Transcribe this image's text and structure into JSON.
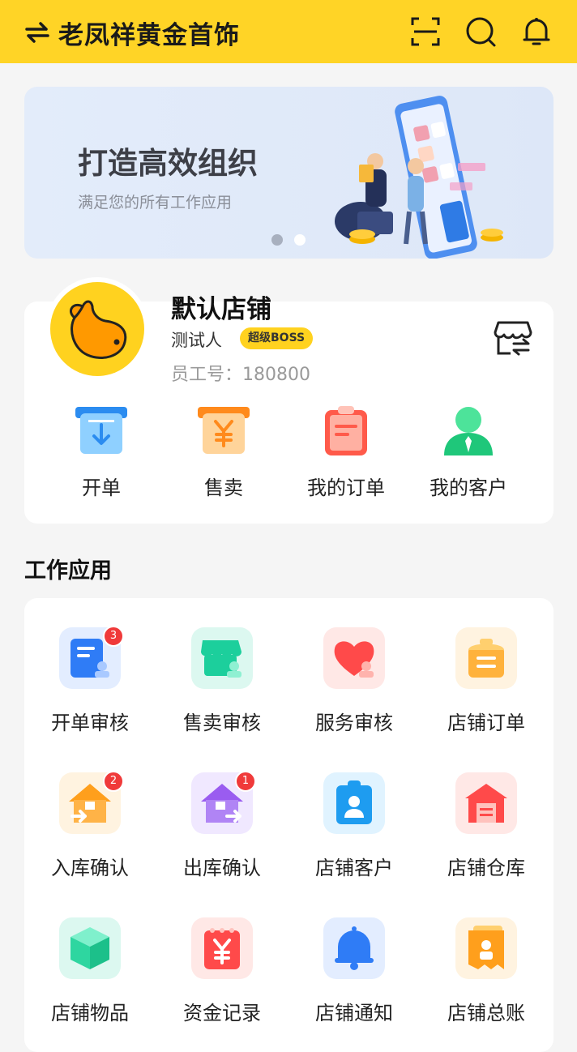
{
  "header": {
    "title": "老凤祥黄金首饰",
    "swap_icon": "swap-arrows-icon",
    "scan_icon": "scan-icon",
    "search_icon": "search-icon",
    "bell_icon": "bell-icon",
    "bg_color": "#ffd426"
  },
  "banner": {
    "title": "打造高效组织",
    "subtitle": "满足您的所有工作应用",
    "active_dot": 0
  },
  "store": {
    "name": "默认店铺",
    "person": "测试人",
    "badge": "超级BOSS",
    "employee_no": "员工号：180800",
    "switch_icon": "store-switch-icon",
    "quick_actions": [
      {
        "label": "开单",
        "icon": "open-order-icon"
      },
      {
        "label": "售卖",
        "icon": "sell-icon"
      },
      {
        "label": "我的订单",
        "icon": "my-orders-icon"
      },
      {
        "label": "我的客户",
        "icon": "my-customers-icon"
      }
    ]
  },
  "work_apps": {
    "title": "工作应用",
    "items": [
      {
        "label": "开单审核",
        "icon": "order-review-icon",
        "badge": "3"
      },
      {
        "label": "售卖审核",
        "icon": "sale-review-icon"
      },
      {
        "label": "服务审核",
        "icon": "service-review-icon"
      },
      {
        "label": "店铺订单",
        "icon": "store-orders-icon"
      },
      {
        "label": "入库确认",
        "icon": "stock-in-icon",
        "badge": "2"
      },
      {
        "label": "出库确认",
        "icon": "stock-out-icon",
        "badge": "1"
      },
      {
        "label": "店铺客户",
        "icon": "store-customers-icon"
      },
      {
        "label": "店铺仓库",
        "icon": "warehouse-icon"
      },
      {
        "label": "店铺物品",
        "icon": "store-goods-icon"
      },
      {
        "label": "资金记录",
        "icon": "funds-record-icon"
      },
      {
        "label": "店铺通知",
        "icon": "store-notice-icon"
      },
      {
        "label": "店铺总账",
        "icon": "ledger-icon"
      }
    ]
  }
}
